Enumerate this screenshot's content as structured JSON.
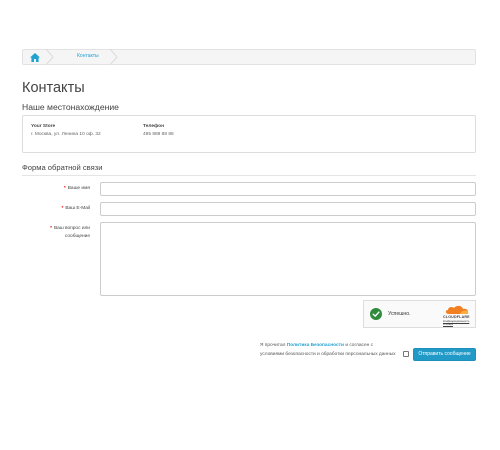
{
  "breadcrumb": {
    "home_icon": "home-icon",
    "current": "Контакты"
  },
  "page_title": "Контакты",
  "location": {
    "title": "Наше местонахождение",
    "store_name": "Your Store",
    "address": "г. Москва, ул. Ленина 10 оф. 32",
    "phone_label": "Телефон",
    "phone": "495 888 88 88"
  },
  "form": {
    "legend": "Форма обратной связи",
    "name_label": "Ваше имя",
    "email_label": "Ваш E-Mail",
    "enquiry_label_1": "Ваш вопрос или",
    "enquiry_label_2": "сообщение",
    "name_value": "",
    "email_value": "",
    "enquiry_value": ""
  },
  "captcha": {
    "status": "Успешно.",
    "brand": "CLOUDFLARE",
    "privacy_link": "Конфиденциальность",
    "terms_link": "Условия"
  },
  "agreement": {
    "text_before": "Я прочитал ",
    "policy_link": "Политика Безопасности",
    "text_after": " и согласен с",
    "line2": "условиями безопасности и обработки персональных данных"
  },
  "submit_label": "Отправить сообщение",
  "colors": {
    "accent": "#229ac8",
    "link": "#23a1d1",
    "required": "#ff0000",
    "success": "#2e8b3a",
    "cloudflare": "#f38020"
  }
}
